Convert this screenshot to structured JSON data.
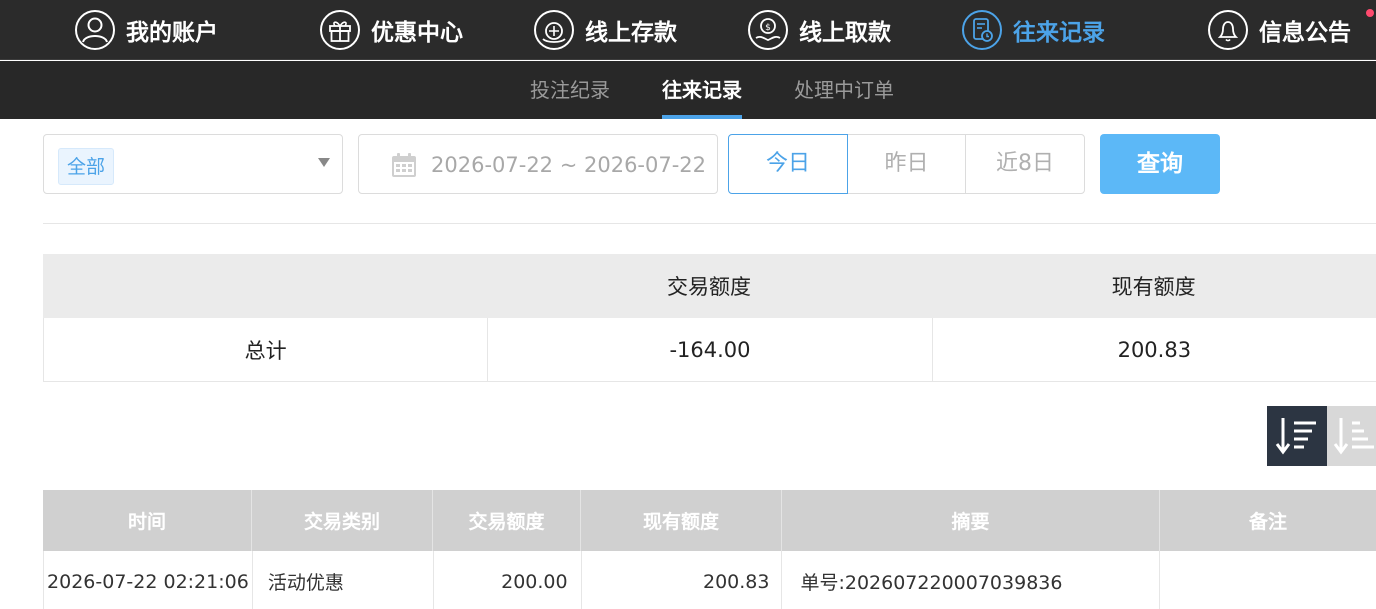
{
  "nav": {
    "items": [
      {
        "label": "我的账户",
        "icon": "user-icon"
      },
      {
        "label": "优惠中心",
        "icon": "gift-icon"
      },
      {
        "label": "线上存款",
        "icon": "deposit-icon"
      },
      {
        "label": "线上取款",
        "icon": "withdraw-icon"
      },
      {
        "label": "往来记录",
        "icon": "records-icon",
        "active": true
      },
      {
        "label": "信息公告",
        "icon": "bell-icon"
      }
    ],
    "accent_color": "#4ca3e8"
  },
  "subnav": {
    "tabs": [
      {
        "label": "投注纪录"
      },
      {
        "label": "往来记录",
        "active": true
      },
      {
        "label": "处理中订单"
      }
    ]
  },
  "filter": {
    "type_selected": "全部",
    "date_range": "2026-07-22 ~ 2026-07-22",
    "quick_ranges": [
      "今日",
      "昨日",
      "近8日"
    ],
    "active_range": "今日",
    "query_label": "查询",
    "query_color": "#5cb8f7"
  },
  "summary": {
    "headers": [
      "",
      "交易额度",
      "现有额度"
    ],
    "row": {
      "label": "总计",
      "transaction_amount": "-164.00",
      "current_balance": "200.83"
    }
  },
  "sort": {
    "desc_icon": "sort-desc-icon",
    "asc_icon": "sort-asc-icon"
  },
  "records": {
    "headers": [
      "时间",
      "交易类别",
      "交易额度",
      "现有额度",
      "摘要",
      "备注"
    ],
    "rows": [
      {
        "time": "2026-07-22 02:21:06",
        "type": "活动优惠",
        "amount": "200.00",
        "balance": "200.83",
        "summary": "单号:202607220007039836",
        "remark": ""
      }
    ]
  }
}
